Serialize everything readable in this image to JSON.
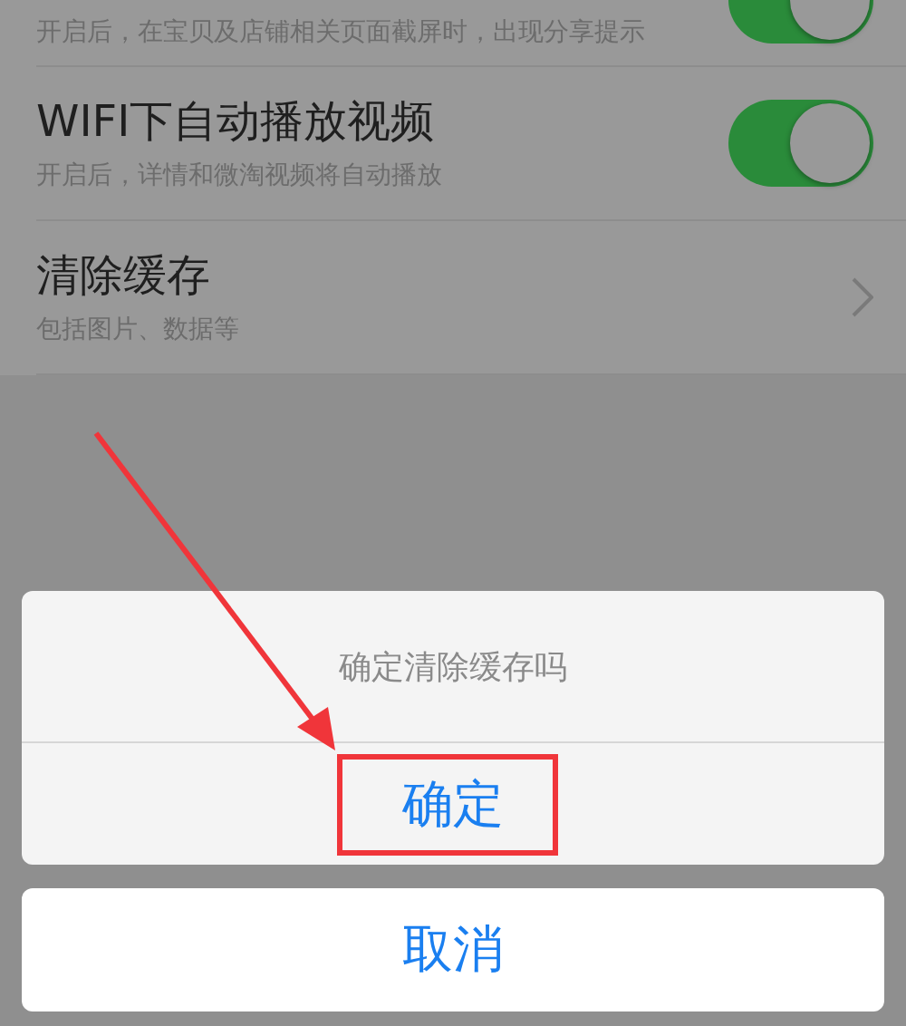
{
  "settings": [
    {
      "kind": "toggle",
      "subtitle": "开启后，在宝贝及店铺相关页面截屏时，出现分享提示",
      "on": true
    },
    {
      "kind": "toggle",
      "title": "WIFI下自动播放视频",
      "subtitle": "开启后，详情和微淘视频将自动播放",
      "on": true
    },
    {
      "kind": "link",
      "title": "清除缓存",
      "subtitle": "包括图片、数据等"
    }
  ],
  "dialog": {
    "message": "确定清除缓存吗",
    "confirm": "确定",
    "cancel": "取消"
  }
}
